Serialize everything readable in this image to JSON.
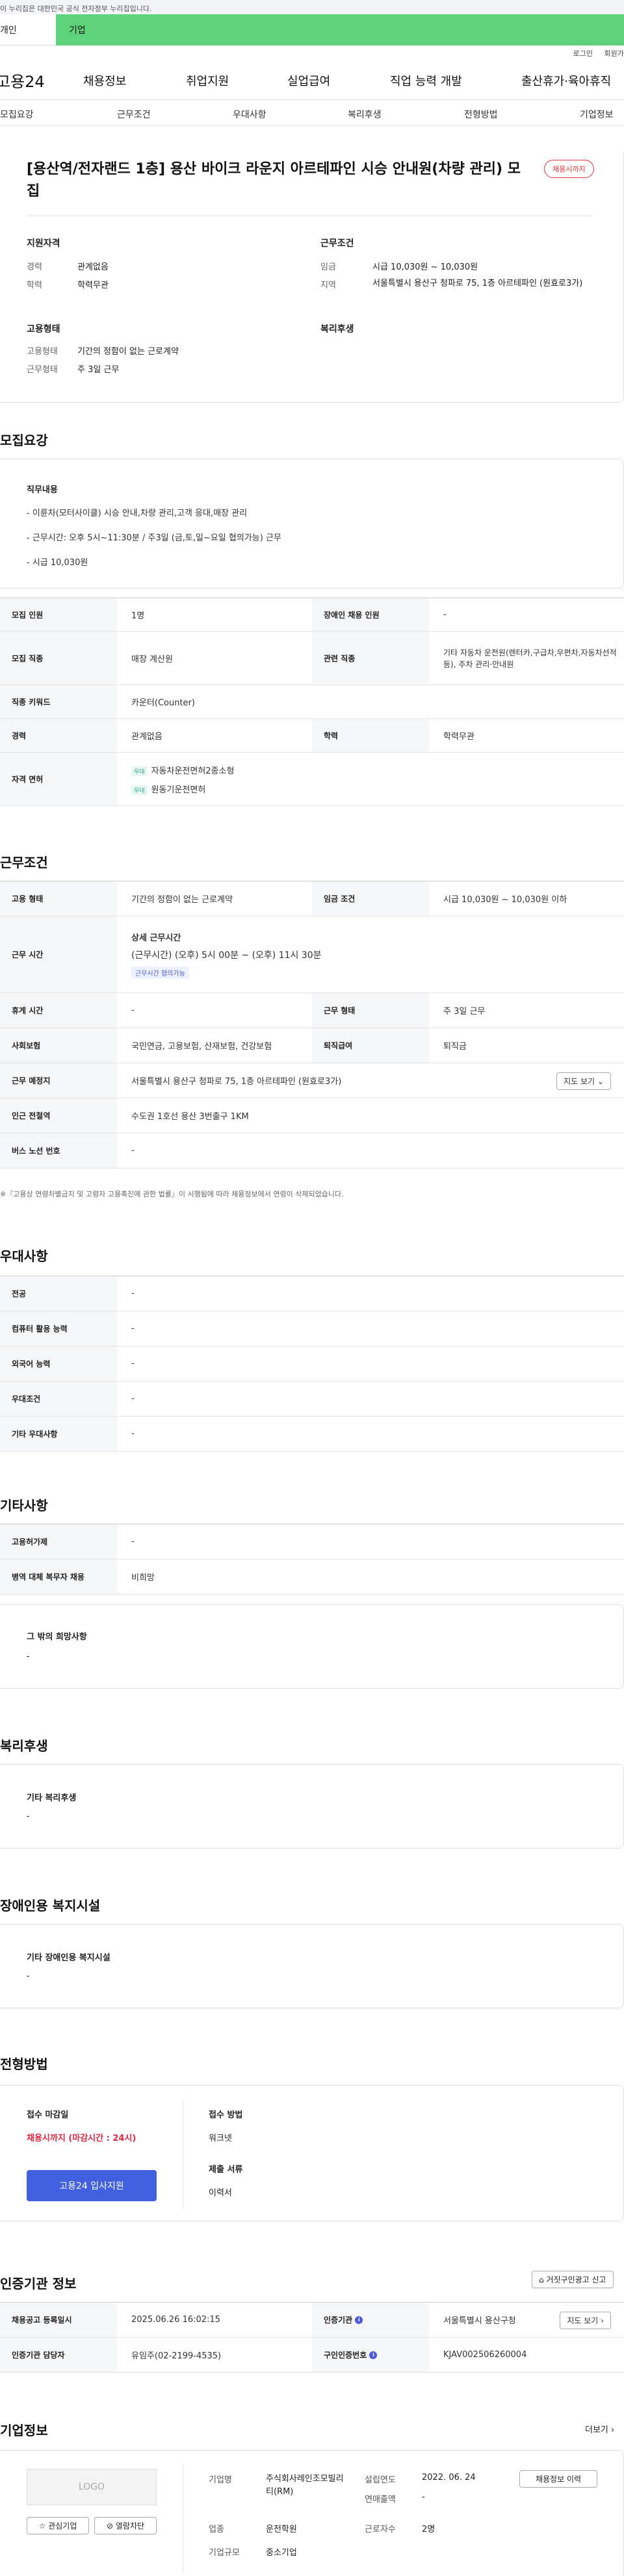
{
  "topbar": {
    "notice": "이 누리집은 대한민국 공식 전자정부 누리집입니다."
  },
  "site_tabs": [
    "개인",
    "기업"
  ],
  "util": {
    "login": "로그인",
    "join": "회원가입"
  },
  "gnb": {
    "logo": "고용24",
    "menu": [
      "채용정보",
      "취업지원",
      "실업급여",
      "직업 능력 개발",
      "출산휴가·육아휴직"
    ]
  },
  "subnav": [
    "모집요강",
    "근무조건",
    "우대사항",
    "복리후생",
    "전형방법",
    "기업정보"
  ],
  "summary": {
    "title": "[용산역/전자랜드 1층] 용산 바이크 라운지 아르테파인 시승 안내원(차량 관리) 모집",
    "badge": "채용시까지",
    "qual_title": "지원자격",
    "career_label": "경력",
    "career": "관계없음",
    "edu_label": "학력",
    "edu": "학력무관",
    "work_title": "근무조건",
    "wage_label": "임금",
    "wage": "시급 10,030원 ~ 10,030원",
    "region_label": "지역",
    "region": "서울특별시 용산구 청파로 75, 1층 아르테파인 (원효로3가)",
    "emp_title": "고용형태",
    "emp_label": "고용형태",
    "emp": "기간의 정함이 없는 근로계약",
    "days_label": "근무형태",
    "days": "주 3일 근무",
    "welfare_title": "복리후생"
  },
  "recruit": {
    "section": "모집요강",
    "duty_title": "직무내용",
    "duties": [
      "- 이륜차(모터사이클) 시승 안내,차량 관리,고객 응대,매장 관리",
      "- 근무시간: 오후 5시~11:30분 / 주3일 (금,토,일~요일 협의가능) 근무",
      "- 시급 10,030원"
    ],
    "rows": {
      "headcount_label": "모집 인원",
      "headcount": "1명",
      "disabled_label": "장애인 채용 인원",
      "disabled": "-",
      "job_label": "모집 직종",
      "job": "매장 계산원",
      "related_label": "관련 직종",
      "related": "기타 자동차 운전원(렌터카,구급차,우편차,자동차선적 등), 주차 관리·안내원",
      "keyword_label": "직종 키워드",
      "keyword": "카운터(Counter)",
      "career_label": "경력",
      "career": "관계없음",
      "edu_label": "학력",
      "edu": "학력무관",
      "license_label": "자격 면허",
      "license_tag": "우대",
      "licenses": [
        "자동차운전면허2종소형",
        "원동기운전면허"
      ]
    }
  },
  "conditions": {
    "section": "근무조건",
    "emp_label": "고용 형태",
    "emp": "기간의 정함이 없는 근로계약",
    "wage_label": "임금 조건",
    "wage": "시급 10,030원 ~ 10,030원 이하",
    "hours_label": "근무 시간",
    "hours_title": "상세 근무시간",
    "hours": "(근무시간) (오후) 5시 00분 ~ (오후) 11시 30분",
    "hours_tag": "근무시간 협의가능",
    "holiday_label": "휴게 시간",
    "holiday": "-",
    "type_label": "근무 형태",
    "type": "주 3일 근무",
    "insurance_label": "사회보험",
    "insurance": "국민연금, 고용보험, 산재보험, 건강보험",
    "retire_label": "퇴직급여",
    "retire": "퇴직금",
    "place_label": "근무 예정지",
    "place": "서울특별시 용산구 청파로 75, 1층 아르테파인 (원효로3가)",
    "map_btn": "지도 보기",
    "subway_label": "인근 전철역",
    "subway": "수도권 1호선 용산 3번출구 1KM",
    "bus_label": "버스 노선 번호",
    "bus": "-",
    "note": "※『고용상 연령차별금지 및 고령자 고용촉진에 관한 법률』이 시행됨에 따라 채용정보에서 연령이 삭제되었습니다."
  },
  "preference": {
    "section": "우대사항",
    "rows": [
      {
        "label": "전공",
        "value": "-"
      },
      {
        "label": "컴퓨터 활용 능력",
        "value": "-"
      },
      {
        "label": "외국어 능력",
        "value": "-"
      },
      {
        "label": "우대조건",
        "value": "-"
      },
      {
        "label": "기타 우대사항",
        "value": "-"
      }
    ]
  },
  "etc": {
    "section": "기타사항",
    "rows": [
      {
        "label": "고용허가제",
        "value": "-"
      },
      {
        "label": "병역 대체 복무자 채용",
        "value": "비희망"
      }
    ],
    "box_title": "그 밖의 희망사항",
    "box_value": "-"
  },
  "welfare": {
    "section": "복리후생",
    "box_title": "기타 복리후생",
    "box_value": "-"
  },
  "facility": {
    "section": "장애인용 복지시설",
    "box_title": "기타 장애인용 복지시설",
    "box_value": "-"
  },
  "process": {
    "section": "전형방법",
    "deadline_label": "접수 마감일",
    "deadline": "채용시까지 (마감시간 : 24시)",
    "apply_btn": "고용24 입사지원",
    "method_label": "접수 방법",
    "method": "워크넷",
    "docs_label": "제출 서류",
    "docs": "이력서"
  },
  "agency": {
    "section": "인증기관 정보",
    "report_btn": "거짓구인광고 신고",
    "date_label": "채용공고 등록일시",
    "date": "2025.06.26 16:02:15",
    "org_label": "인증기관",
    "org": "서울특별시 용산구청",
    "map_btn": "지도 보기",
    "staff_label": "인증기관 담당자",
    "staff": "유임주(02-2199-4535)",
    "num_label": "구인인증번호",
    "num": "KJAV002506260004"
  },
  "company": {
    "section": "기업정보",
    "more": "더보기",
    "logo": "LOGO",
    "fav_btn": "관심기업",
    "block_btn": "열람차단",
    "name_label": "기업명",
    "name": "주식회사레인조모빌리티(RM)",
    "year_label": "설립연도",
    "year": "2022. 06. 24",
    "sales_label": "연매출액",
    "sales": "-",
    "industry_label": "업종",
    "industry": "운전학원",
    "staff_label": "근로자수",
    "staff": "2명",
    "size_label": "기업규모",
    "size": "중소기업",
    "jobs_btn": "채용정보 이력"
  }
}
